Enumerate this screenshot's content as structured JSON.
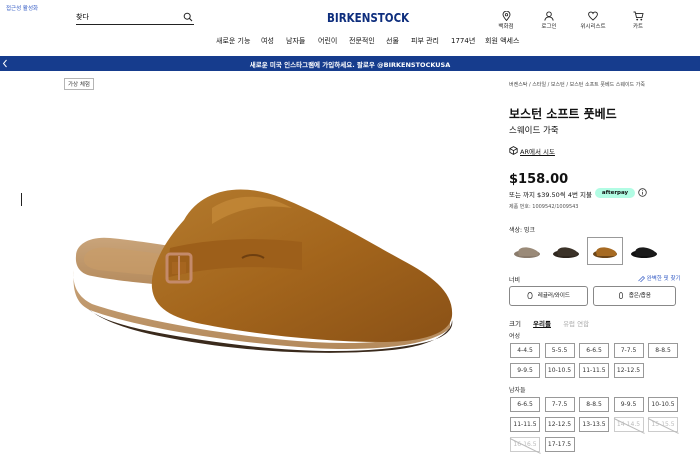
{
  "header": {
    "accessibility_label": "접근성 활성화",
    "search": {
      "value": "찾다",
      "placeholder": "찾다"
    },
    "logo_text": "BIRKENSTOCK",
    "icons": [
      {
        "name": "location-icon",
        "label": "백화점"
      },
      {
        "name": "user-icon",
        "label": "로그인"
      },
      {
        "name": "heart-icon",
        "label": "위시리스트"
      },
      {
        "name": "cart-icon",
        "label": "카트"
      }
    ]
  },
  "nav": {
    "items": [
      "새로운 기능",
      "여성",
      "남자들",
      "어린이",
      "전문적인",
      "선물",
      "피부 관리",
      "1774년",
      "회원 액세스"
    ]
  },
  "banner": {
    "text": "새로운 미국 인스타그램에 가입하세요. 팔로우 @BIRKENSTOCKUSA",
    "arrow_icon": "chevron-left-icon",
    "background": "#163c8d"
  },
  "gallery": {
    "ar_tag": "가상 체험",
    "product_image_label": "Boston suede clog, mink"
  },
  "product": {
    "breadcrumb": "버켄스탁 / 스타일 / 보스턴 / 보스턴 소프트 풋베드 스웨이드 가죽",
    "title": "보스턴 소프트 풋베드",
    "subtitle": "스웨이드 가죽",
    "ar_link": "AR에서 시도",
    "price": "$158.00",
    "installment": "또는 까지 $39.50씩 4번 지불",
    "afterpay_label": "afterpay",
    "product_number": "제품 번호: 1009542/1009543",
    "color_label": "색상: 밍크",
    "swatches": [
      {
        "name": "taupe",
        "color": "#8a7b6c",
        "selected": false
      },
      {
        "name": "black-brown",
        "color": "#3b3228",
        "selected": false
      },
      {
        "name": "mink",
        "color": "#a66a22",
        "selected": true
      },
      {
        "name": "black",
        "color": "#1a1a1a",
        "selected": false
      }
    ],
    "width_label": "너비",
    "fit_link": "완벽한 핏 찾기",
    "width_options": [
      "레귤러/와이드",
      "좁은/좁음"
    ],
    "size_tabs": {
      "us": "크기",
      "eu": "우리를",
      "uk": "유럽 연합"
    },
    "women_label": "여성",
    "women_sizes": [
      {
        "label": "4-4.5",
        "available": true
      },
      {
        "label": "5-5.5",
        "available": true
      },
      {
        "label": "6-6.5",
        "available": true
      },
      {
        "label": "7-7.5",
        "available": true
      },
      {
        "label": "8-8.5",
        "available": true
      },
      {
        "label": "9-9.5",
        "available": true
      },
      {
        "label": "10-10.5",
        "available": true
      },
      {
        "label": "11-11.5",
        "available": true
      },
      {
        "label": "12-12.5",
        "available": true
      }
    ],
    "men_label": "남자들",
    "men_sizes": [
      {
        "label": "6-6.5",
        "available": true
      },
      {
        "label": "7-7.5",
        "available": true
      },
      {
        "label": "8-8.5",
        "available": true
      },
      {
        "label": "9-9.5",
        "available": true
      },
      {
        "label": "10-10.5",
        "available": true
      },
      {
        "label": "11-11.5",
        "available": true
      },
      {
        "label": "12-12.5",
        "available": true
      },
      {
        "label": "13-13.5",
        "available": true
      },
      {
        "label": "14-14.5",
        "available": false
      },
      {
        "label": "15-15.5",
        "available": false
      },
      {
        "label": "16-16.5",
        "available": false
      },
      {
        "label": "17-17.5",
        "available": true
      }
    ]
  }
}
